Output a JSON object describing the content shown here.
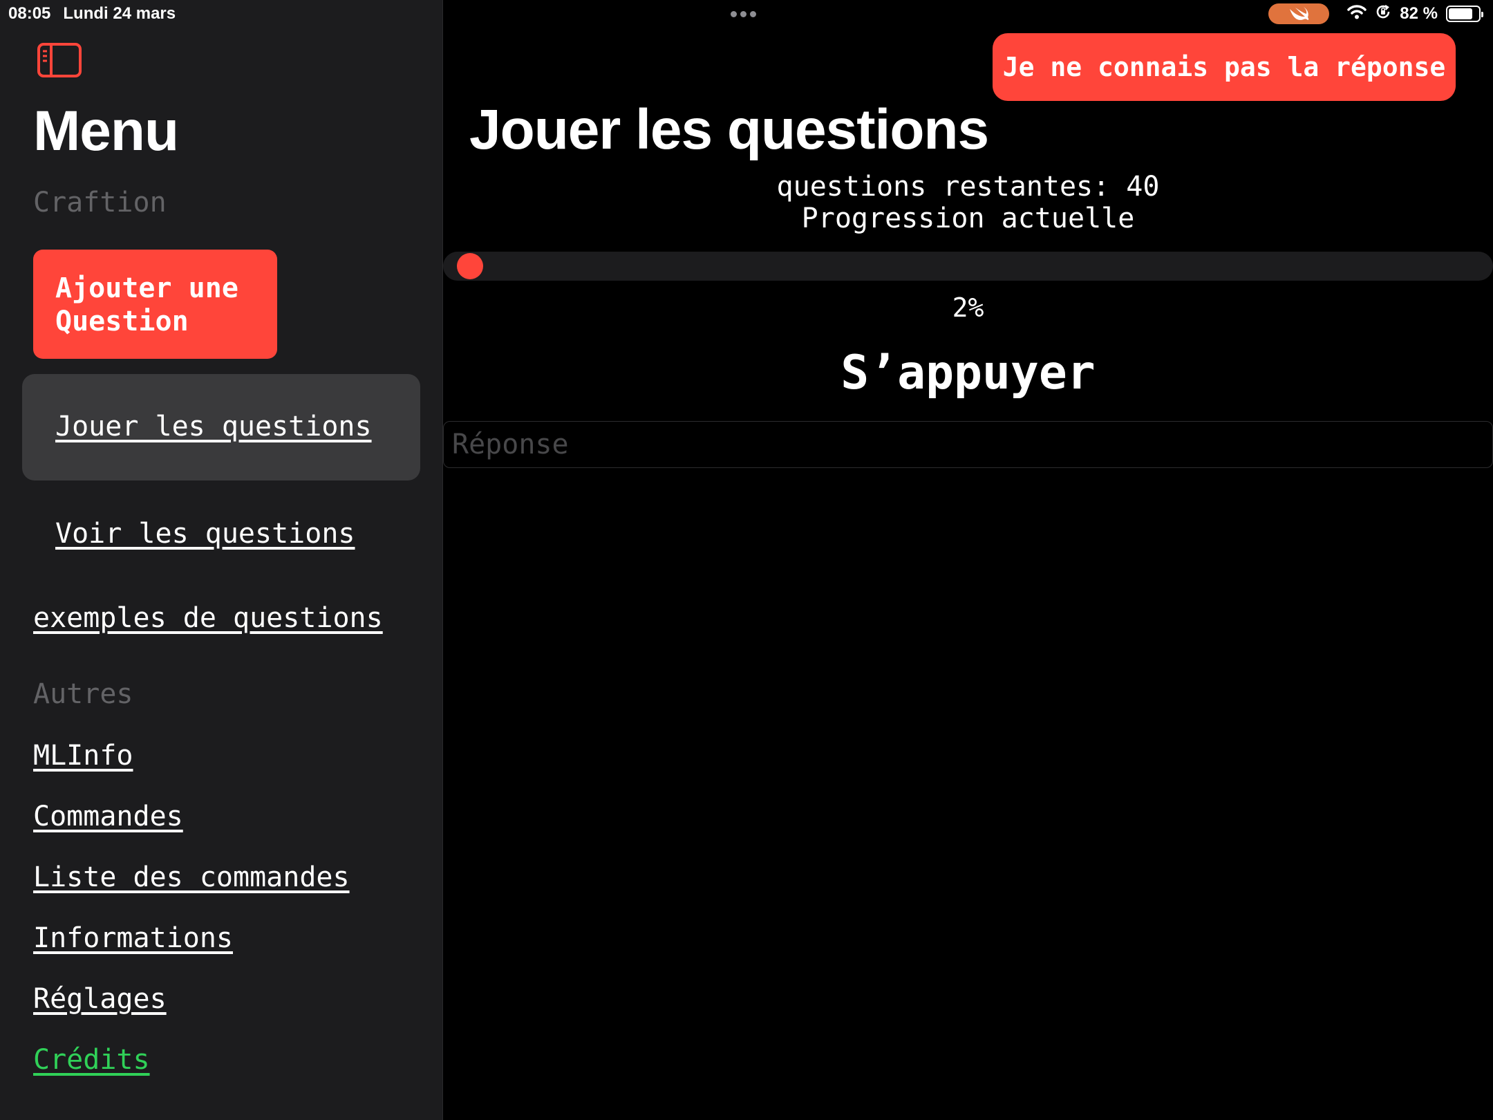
{
  "status_bar": {
    "time": "08:05",
    "date": "Lundi 24 mars",
    "battery": "82 %",
    "battery_level": 0.82
  },
  "sidebar": {
    "title": "Menu",
    "section_craftion": "Craftion",
    "add_button": "Ajouter une Question",
    "items": [
      {
        "label": "Jouer les questions",
        "selected": true
      },
      {
        "label": "Voir les questions"
      },
      {
        "label": "exemples de questions"
      }
    ],
    "section_autres": "Autres",
    "other_items": [
      {
        "label": "MLInfo"
      },
      {
        "label": "Commandes"
      },
      {
        "label": "Liste des commandes"
      },
      {
        "label": "Informations"
      },
      {
        "label": "Réglages"
      },
      {
        "label": "Crédits",
        "color": "#30d158"
      }
    ]
  },
  "main": {
    "dont_know_button": "Je ne connais pas la réponse",
    "title": "Jouer les questions",
    "remaining": "questions restantes: 40",
    "progress_label": "Progression actuelle",
    "progress_value": 0.02,
    "progress_percent": "2%",
    "question": "S’appuyer",
    "answer_placeholder": "Réponse"
  },
  "colors": {
    "accent": "#ff453a",
    "sidebar_bg": "#1c1c1e",
    "selected_bg": "#3a3a3c",
    "credits": "#30d158",
    "section_label": "#636366"
  }
}
